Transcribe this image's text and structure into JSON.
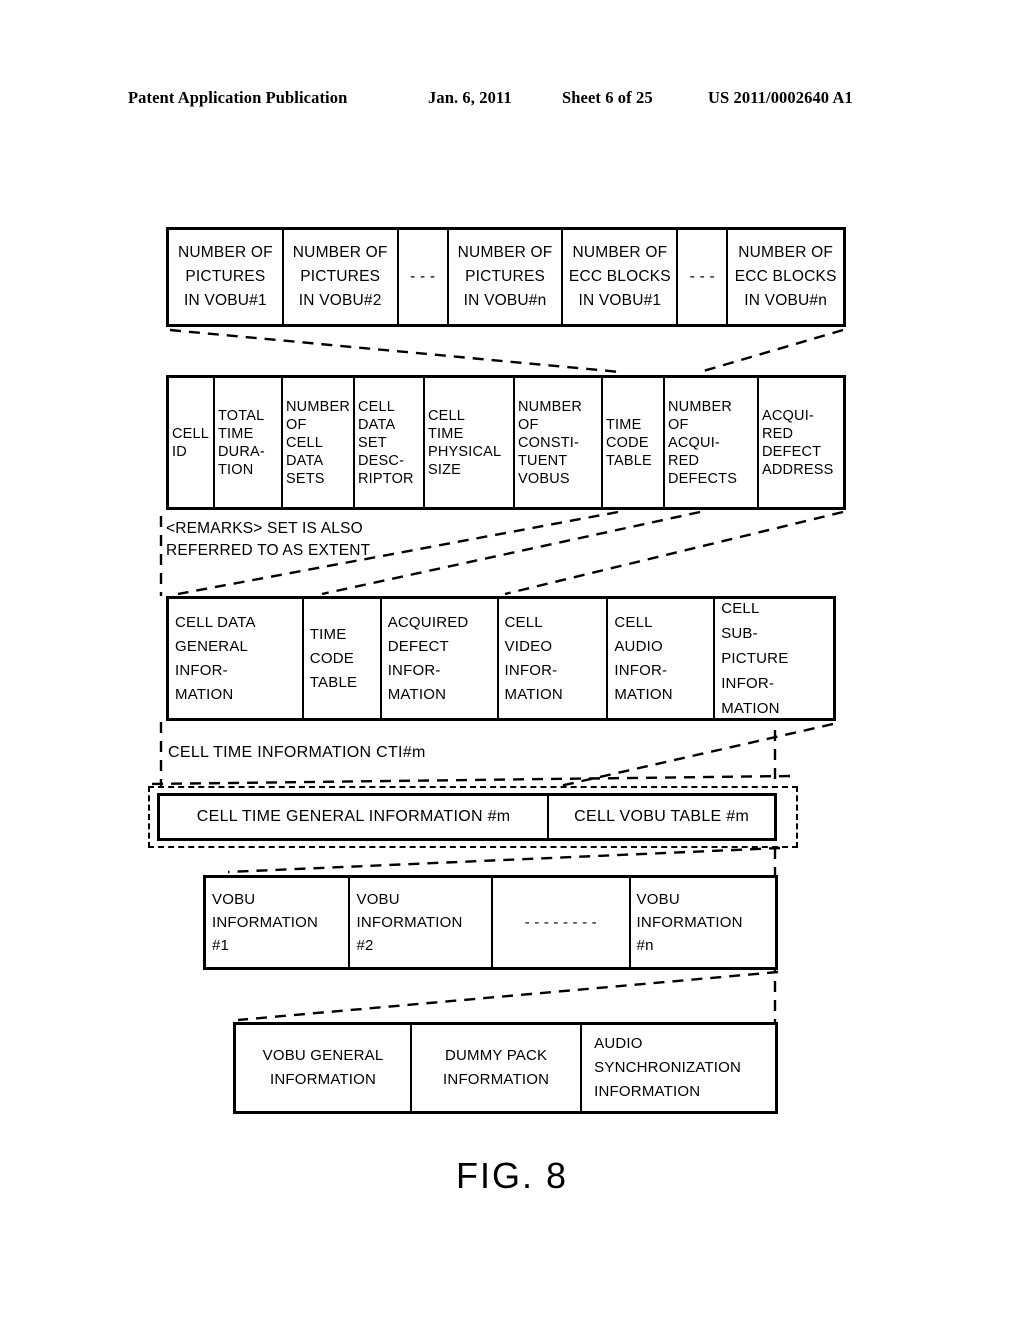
{
  "header": {
    "publication": "Patent Application Publication",
    "date": "Jan. 6, 2011",
    "sheet": "Sheet 6 of 25",
    "number": "US 2011/0002640 A1"
  },
  "figure": {
    "label": "FIG. 8",
    "remarks": "<REMARKS> SET IS ALSO\nREFERRED TO AS EXTENT",
    "cti_label": "CELL TIME INFORMATION CTI#m"
  },
  "row1": {
    "name": "vobu-picture-ecc-table",
    "cells": [
      {
        "text": "NUMBER OF\nPICTURES\nIN VOBU#1",
        "type": "label"
      },
      {
        "text": "NUMBER OF\nPICTURES\nIN VOBU#2",
        "type": "label"
      },
      {
        "text": "- - -",
        "type": "ellipsis"
      },
      {
        "text": "NUMBER OF\nPICTURES\nIN VOBU#n",
        "type": "label"
      },
      {
        "text": "NUMBER OF\nECC BLOCKS\nIN VOBU#1",
        "type": "label"
      },
      {
        "text": "- - -",
        "type": "ellipsis"
      },
      {
        "text": "NUMBER OF\nECC BLOCKS\nIN VOBU#n",
        "type": "label"
      }
    ]
  },
  "row2": {
    "name": "cell-data-set-descriptor-table",
    "cells": [
      {
        "text": "CELL\nID"
      },
      {
        "text": "TOTAL\nTIME\nDURA-\nTION"
      },
      {
        "text": "NUMBER\nOF\nCELL\nDATA\nSETS"
      },
      {
        "text": "CELL\nDATA\nSET\nDESC-\nRIPTOR"
      },
      {
        "text": "CELL\nTIME\nPHYSICAL\nSIZE"
      },
      {
        "text": "NUMBER\nOF\nCONSTI-\nTUENT\nVOBUS"
      },
      {
        "text": "TIME\nCODE\nTABLE"
      },
      {
        "text": "NUMBER\nOF\nACQUI-\nRED\nDEFECTS"
      },
      {
        "text": "ACQUI-\nRED\nDEFECT\nADDRESS"
      }
    ]
  },
  "row3": {
    "name": "cell-data-general-information-table",
    "cells": [
      {
        "text": "CELL DATA\nGENERAL\nINFOR-\nMATION"
      },
      {
        "text": "TIME\nCODE\nTABLE"
      },
      {
        "text": "ACQUIRED\nDEFECT\nINFOR-\nMATION"
      },
      {
        "text": "CELL\nVIDEO\nINFOR-\nMATION"
      },
      {
        "text": "CELL\nAUDIO\nINFOR-\nMATION"
      },
      {
        "text": "CELL\nSUB-\nPICTURE\nINFOR-\nMATION"
      }
    ]
  },
  "row4": {
    "name": "cell-time-information-table",
    "cells": [
      {
        "text": "CELL TIME GENERAL INFORMATION #m"
      },
      {
        "text": "CELL VOBU TABLE #m"
      }
    ]
  },
  "row5": {
    "name": "vobu-information-table",
    "cells": [
      {
        "text": "VOBU\nINFORMATION\n#1",
        "type": "label"
      },
      {
        "text": "VOBU\nINFORMATION\n#2",
        "type": "label"
      },
      {
        "text": "- - - - - - - -",
        "type": "ellipsis"
      },
      {
        "text": "VOBU\nINFORMATION\n#n",
        "type": "label"
      }
    ]
  },
  "row6": {
    "name": "vobu-detail-table",
    "cells": [
      {
        "text": "VOBU GENERAL\nINFORMATION"
      },
      {
        "text": "DUMMY PACK\nINFORMATION"
      },
      {
        "text": "AUDIO\nSYNCHRONIZATION\nINFORMATION"
      }
    ]
  }
}
